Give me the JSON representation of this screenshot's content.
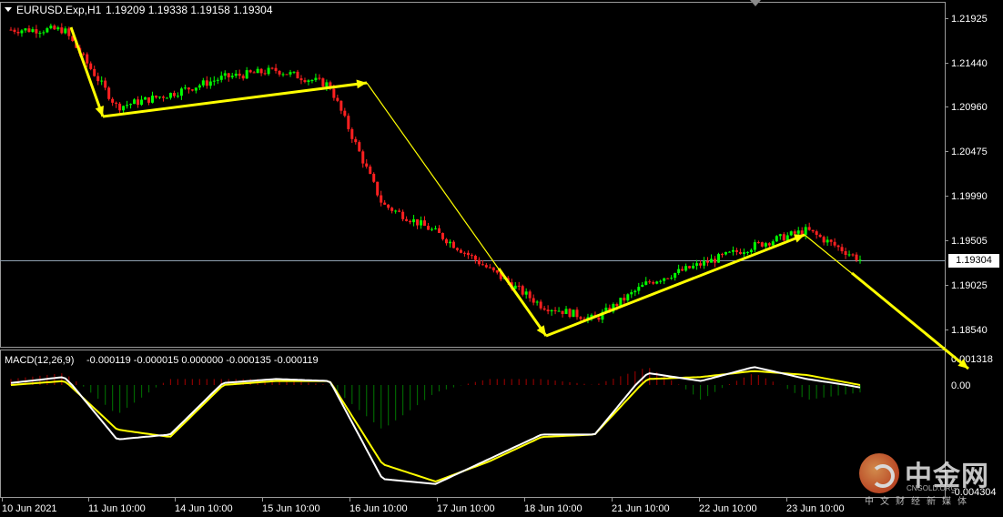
{
  "header": {
    "symbol": "EURUSD.Exp,H1",
    "ohlc": "1.19209 1.19338 1.19158 1.19304"
  },
  "price_axis": {
    "ticks": [
      "1.21925",
      "1.21440",
      "1.20960",
      "1.20475",
      "1.19990",
      "1.19505",
      "1.19025",
      "1.18540"
    ],
    "current": "1.19304"
  },
  "macd": {
    "title": "MACD(12,26,9)",
    "values": "-0.000119 -0.000015 0.000000 -0.000135 -0.000119",
    "axis_ticks": [
      "0.001318",
      "0.00",
      "-0.004304"
    ]
  },
  "time_axis": {
    "labels": [
      "10 Jun 2021",
      "11 Jun 10:00",
      "14 Jun 10:00",
      "15 Jun 10:00",
      "16 Jun 10:00",
      "17 Jun 10:00",
      "18 Jun 10:00",
      "21 Jun 10:00",
      "22 Jun 10:00",
      "23 Jun 10:00"
    ]
  },
  "watermark": {
    "name": "中金网",
    "site": "CNGOLD.ORG",
    "tagline": "中文财经新媒体"
  },
  "colors": {
    "bull": "#00ff00",
    "bear": "#ff2020",
    "arrow": "#ffff00",
    "macd_line": "#ffffff",
    "signal_line": "#ffff00",
    "hist_pos": "#8b0000",
    "hist_neg": "#006400"
  },
  "chart_data": [
    {
      "type": "line",
      "title": "EURUSD.Exp,H1",
      "ylim": [
        1.184,
        1.222
      ],
      "x": [
        "10 Jun 2021",
        "11 Jun 10:00",
        "11 Jun 16:00",
        "14 Jun 10:00",
        "15 Jun 10:00",
        "15 Jun 22:00",
        "16 Jun 10:00",
        "16 Jun 22:00",
        "17 Jun 10:00",
        "17 Jun 22:00",
        "18 Jun 10:00",
        "18 Jun 16:00",
        "21 Jun 10:00",
        "22 Jun 10:00",
        "22 Jun 22:00",
        "23 Jun 10:00",
        "23 Jun 16:00"
      ],
      "series": [
        {
          "values": [
            1.218,
            1.218,
            1.2096,
            1.211,
            1.2128,
            1.2136,
            1.212,
            1.199,
            1.196,
            1.192,
            1.188,
            1.1865,
            1.1905,
            1.1925,
            1.1945,
            1.1962,
            1.193
          ]
        }
      ]
    },
    {
      "type": "line",
      "title": "MACD(12,26,9)",
      "ylim": [
        -0.004304,
        0.001318
      ],
      "series": [
        {
          "name": "MACD",
          "values": [
            0.0001,
            0.0004,
            -0.0022,
            -0.002,
            0.0001,
            0.0003,
            0.0002,
            -0.0038,
            -0.004,
            -0.003,
            -0.002,
            -0.002,
            0.0006,
            0.0002,
            0.0009,
            0.0003,
            -0.0001
          ]
        },
        {
          "name": "Signal",
          "values": [
            0.0,
            0.0002,
            -0.0018,
            -0.0021,
            0.0,
            0.0002,
            0.0002,
            -0.0032,
            -0.0039,
            -0.0031,
            -0.0021,
            -0.002,
            0.0003,
            0.0004,
            0.0007,
            0.0005,
            0.0
          ]
        }
      ]
    }
  ]
}
